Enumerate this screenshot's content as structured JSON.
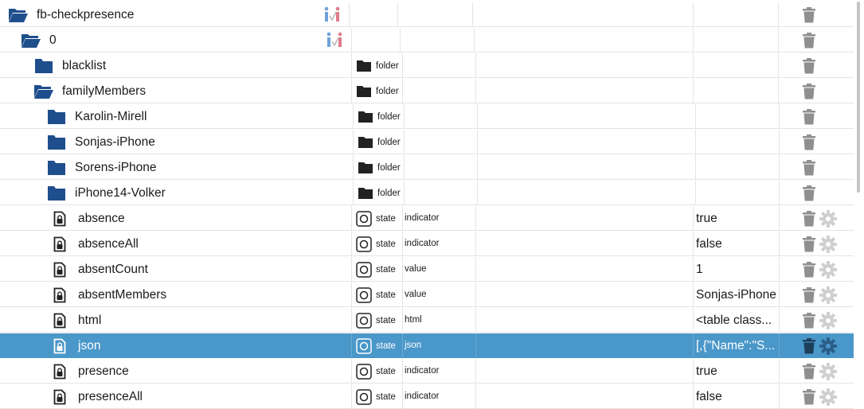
{
  "rows": [
    {
      "name": "fb-checkpresence",
      "icon": "folder-open-icon",
      "type": "",
      "role": "",
      "value": "",
      "gear": false,
      "selected": false
    },
    {
      "name": "0",
      "icon": "folder-open-icon",
      "type": "",
      "role": "",
      "value": "",
      "gear": false,
      "selected": false
    },
    {
      "name": "blacklist",
      "icon": "folder-icon",
      "type": "folder",
      "role": "",
      "value": "",
      "gear": false,
      "selected": false
    },
    {
      "name": "familyMembers",
      "icon": "folder-open-icon",
      "type": "folder",
      "role": "",
      "value": "",
      "gear": false,
      "selected": false
    },
    {
      "name": "Karolin-Mirell",
      "icon": "folder-icon",
      "type": "folder",
      "role": "",
      "value": "",
      "gear": false,
      "selected": false
    },
    {
      "name": "Sonjas-iPhone",
      "icon": "folder-icon",
      "type": "folder",
      "role": "",
      "value": "",
      "gear": false,
      "selected": false
    },
    {
      "name": "Sorens-iPhone",
      "icon": "folder-icon",
      "type": "folder",
      "role": "",
      "value": "",
      "gear": false,
      "selected": false
    },
    {
      "name": "iPhone14-Volker",
      "icon": "folder-icon",
      "type": "folder",
      "role": "",
      "value": "",
      "gear": false,
      "selected": false
    },
    {
      "name": "absence",
      "icon": "locked-file-icon",
      "type": "state",
      "role": "indicator",
      "value": "true",
      "gear": true,
      "selected": false
    },
    {
      "name": "absenceAll",
      "icon": "locked-file-icon",
      "type": "state",
      "role": "indicator",
      "value": "false",
      "gear": true,
      "selected": false
    },
    {
      "name": "absentCount",
      "icon": "locked-file-icon",
      "type": "state",
      "role": "value",
      "value": "1",
      "gear": true,
      "selected": false
    },
    {
      "name": "absentMembers",
      "icon": "locked-file-icon",
      "type": "state",
      "role": "value",
      "value": "Sonjas-iPhone",
      "gear": true,
      "selected": false
    },
    {
      "name": "html",
      "icon": "locked-file-icon",
      "type": "state",
      "role": "html",
      "value": "<table class...",
      "gear": true,
      "selected": false
    },
    {
      "name": "json",
      "icon": "locked-file-icon",
      "type": "state",
      "role": "json",
      "value": "[,{\"Name\":\"S...",
      "gear": true,
      "selected": true
    },
    {
      "name": "presence",
      "icon": "locked-file-icon",
      "type": "state",
      "role": "indicator",
      "value": "true",
      "gear": true,
      "selected": false
    },
    {
      "name": "presenceAll",
      "icon": "locked-file-icon",
      "type": "state",
      "role": "indicator",
      "value": "false",
      "gear": true,
      "selected": false
    }
  ],
  "colors": {
    "folder": "#1f4e8c",
    "selected_row": "#4a97c9",
    "trash": "#8f8f8f",
    "gear": "#cfcfcf"
  }
}
